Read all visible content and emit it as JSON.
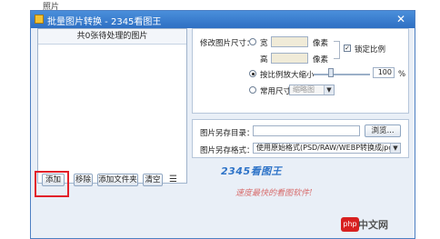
{
  "caption": "照片",
  "window": {
    "title": "批量图片转换 - 2345看图王",
    "close_glyph": "✕"
  },
  "left_panel": {
    "header": "共0张待处理的图片"
  },
  "buttons": {
    "add": "添加",
    "remove": "移除",
    "add_folder": "添加文件夹",
    "clear": "清空",
    "list_icon_glyph": "☰"
  },
  "resize": {
    "label": "修改图片尺寸：",
    "width_label": "宽",
    "width_unit": "像素",
    "height_label": "高",
    "height_unit": "像素",
    "lock_label": "锁定比例",
    "lock_checked": true,
    "ratio_label": "按比例放大缩小",
    "ratio_value": "100",
    "ratio_unit": "%",
    "common_label": "常用尺寸",
    "common_placeholder": "缩略图",
    "selected_mode": "ratio",
    "slider_percent": 30
  },
  "output": {
    "dir_label": "图片另存目录：",
    "dir_value": "",
    "browse_label": "浏览...",
    "format_label": "图片另存格式：",
    "format_value": "使用原始格式(PSD/RAW/WEBP转换成jpg)"
  },
  "branding": {
    "logo": "2345看图王",
    "slogan": "速度最快的看图软件!"
  },
  "watermark": {
    "icon": "php",
    "text": "中文网"
  }
}
